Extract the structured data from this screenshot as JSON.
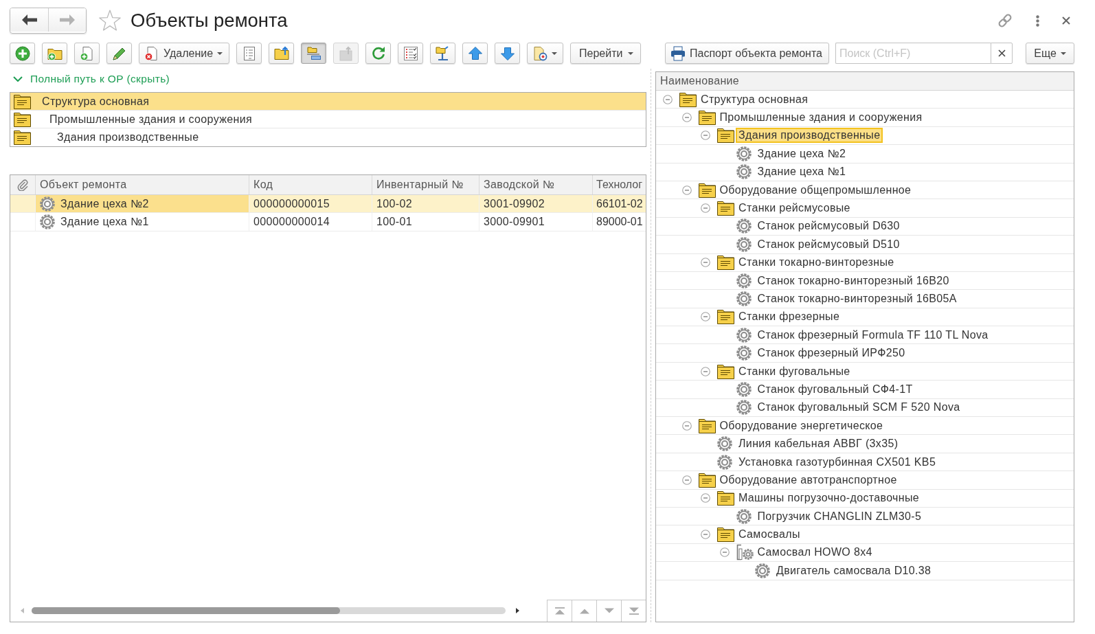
{
  "window": {
    "title": "Объекты ремонта",
    "favorite": false
  },
  "navigation": [
    {
      "kind": "back",
      "disabled": false
    },
    {
      "kind": "forward",
      "disabled": true
    }
  ],
  "toolbar": [
    {
      "kind": "add",
      "dropdown": false,
      "pressed": false,
      "disabled": false
    },
    {
      "kind": "add_group",
      "dropdown": false,
      "pressed": false,
      "disabled": false
    },
    {
      "kind": "copy",
      "dropdown": false,
      "pressed": false,
      "disabled": false
    },
    {
      "kind": "edit",
      "dropdown": false,
      "pressed": false,
      "disabled": false
    },
    {
      "kind": "delete",
      "label": "Удаление",
      "dropdown": true,
      "pressed": false,
      "disabled": false
    },
    {
      "kind": "list",
      "dropdown": false,
      "pressed": false,
      "disabled": false
    },
    {
      "kind": "level_up",
      "dropdown": false,
      "pressed": false,
      "disabled": false
    },
    {
      "kind": "hierarchy",
      "dropdown": false,
      "pressed": true,
      "disabled": false
    },
    {
      "kind": "level_down",
      "dropdown": false,
      "pressed": false,
      "disabled": true
    },
    {
      "kind": "refresh",
      "dropdown": false,
      "pressed": false,
      "disabled": false
    },
    {
      "kind": "list_settings",
      "dropdown": false,
      "pressed": false,
      "disabled": false
    },
    {
      "kind": "move_to_group",
      "dropdown": false,
      "pressed": false,
      "disabled": false
    },
    {
      "kind": "move_up",
      "dropdown": false,
      "pressed": false,
      "disabled": false
    },
    {
      "kind": "move_down",
      "dropdown": false,
      "pressed": false,
      "disabled": false
    },
    {
      "kind": "document_settings",
      "dropdown": true,
      "pressed": false,
      "disabled": false
    },
    {
      "kind": "menu",
      "label": "Перейти",
      "dropdown": true,
      "pressed": false,
      "disabled": false
    },
    {
      "kind": "print",
      "label": "Паспорт объекта ремонта",
      "dropdown": false,
      "pressed": false,
      "disabled": false
    }
  ],
  "search": {
    "placeholder": "Поиск (Ctrl+F)"
  },
  "more_button": {
    "label": "Еще",
    "dropdown": true
  },
  "path": {
    "title": "Полный путь к ОР (скрыть)",
    "expanded": true,
    "items": [
      {
        "label": "Структура основная",
        "selected": true,
        "children": [
          {
            "label": "Промышленные здания и сооружения",
            "selected": false,
            "children": [
              {
                "label": "Здания производственные",
                "selected": false
              }
            ]
          }
        ]
      }
    ]
  },
  "table": {
    "columns": [
      "Объект ремонта",
      "Код",
      "Инвентарный №",
      "Заводской №",
      "Технолог"
    ],
    "rows": [
      {
        "cells": [
          "Здание цеха №2",
          "000000000015",
          "100-02",
          "3001-09902",
          "66101-02"
        ],
        "selected": true
      },
      {
        "cells": [
          "Здание цеха №1",
          "000000000014",
          "100-01",
          "3000-09901",
          "89000-01"
        ],
        "selected": false
      }
    ]
  },
  "tree": {
    "columns": [
      "Наименование"
    ],
    "items": [
      {
        "label": "Структура основная",
        "kind": "group",
        "expanded": true,
        "selected": false,
        "children": [
          {
            "label": "Промышленные здания и сооружения",
            "kind": "group",
            "expanded": true,
            "selected": false,
            "children": [
              {
                "label": "Здания производственные",
                "kind": "group",
                "expanded": true,
                "selected": true,
                "children": [
                  {
                    "label": "Здание цеха №2",
                    "kind": "object",
                    "selected": false
                  },
                  {
                    "label": "Здание цеха №1",
                    "kind": "object",
                    "selected": false
                  }
                ]
              }
            ]
          },
          {
            "label": "Оборудование общепромышленное",
            "kind": "group",
            "expanded": true,
            "selected": false,
            "children": [
              {
                "label": "Станки рейсмусовые",
                "kind": "group",
                "expanded": true,
                "selected": false,
                "children": [
                  {
                    "label": "Станок рейсмусовый D630",
                    "kind": "object",
                    "selected": false
                  },
                  {
                    "label": "Станок рейсмусовый D510",
                    "kind": "object",
                    "selected": false
                  }
                ]
              },
              {
                "label": "Станки токарно-винторезные",
                "kind": "group",
                "expanded": true,
                "selected": false,
                "children": [
                  {
                    "label": "Станок токарно-винторезный 16В20",
                    "kind": "object",
                    "selected": false
                  },
                  {
                    "label": "Станок токарно-винторезный 16В05А",
                    "kind": "object",
                    "selected": false
                  }
                ]
              },
              {
                "label": "Станки фрезерные",
                "kind": "group",
                "expanded": true,
                "selected": false,
                "children": [
                  {
                    "label": "Станок фрезерный Formula TF 110 TL Nova",
                    "kind": "object",
                    "selected": false
                  },
                  {
                    "label": "Станок фрезерный ИРФ250",
                    "kind": "object",
                    "selected": false
                  }
                ]
              },
              {
                "label": "Станки фуговальные",
                "kind": "group",
                "expanded": true,
                "selected": false,
                "children": [
                  {
                    "label": "Станок фуговальный СФ4-1Т",
                    "kind": "object",
                    "selected": false
                  },
                  {
                    "label": "Станок фуговальный SCM F 520 Nova",
                    "kind": "object",
                    "selected": false
                  }
                ]
              }
            ]
          },
          {
            "label": "Оборудование энергетическое",
            "kind": "group",
            "expanded": true,
            "selected": false,
            "children": [
              {
                "label": "Линия кабельная АВВГ (3х35)",
                "kind": "object",
                "selected": false
              },
              {
                "label": "Установка газотурбинная CX501 KB5",
                "kind": "object",
                "selected": false
              }
            ]
          },
          {
            "label": "Оборудование автотранспортное",
            "kind": "group",
            "expanded": true,
            "selected": false,
            "children": [
              {
                "label": "Машины погрузочно-доставочные",
                "kind": "group",
                "expanded": true,
                "selected": false,
                "children": [
                  {
                    "label": "Погрузчик CHANGLIN ZLM30-5",
                    "kind": "object",
                    "selected": false
                  }
                ]
              },
              {
                "label": "Самосвалы",
                "kind": "group",
                "expanded": true,
                "selected": false,
                "children": [
                  {
                    "label": "Самосвал HOWO 8x4",
                    "kind": "composite",
                    "expanded": true,
                    "selected": false,
                    "children": [
                      {
                        "label": "Двигатель самосвала D10.38",
                        "kind": "object",
                        "selected": false
                      }
                    ]
                  }
                ]
              }
            ]
          }
        ]
      }
    ]
  }
}
